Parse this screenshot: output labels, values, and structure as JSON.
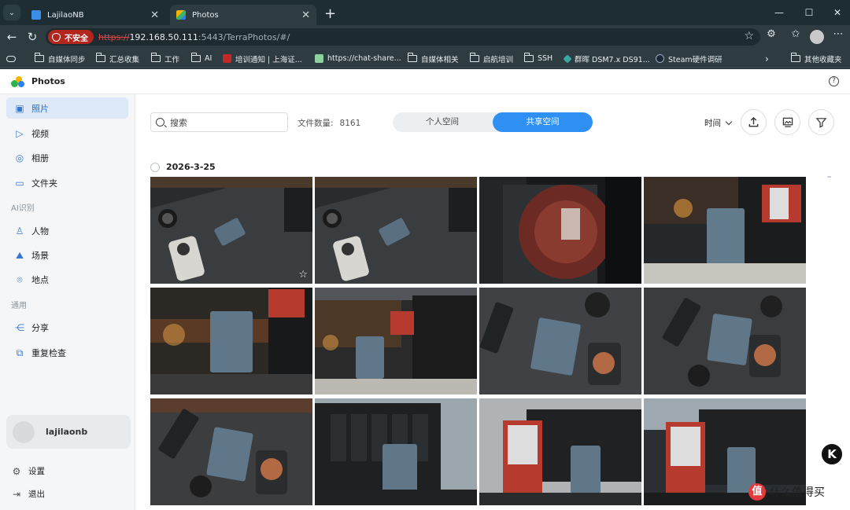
{
  "browser": {
    "tabs": [
      {
        "label": "LajilaoNB",
        "color": "#3a8ee6"
      },
      {
        "label": "Photos",
        "color": "#3bb36b"
      }
    ],
    "url": {
      "security_label": "不安全",
      "scheme": "https://",
      "host": "192.168.50.111",
      "path": ":5443/TerraPhotos/#/"
    },
    "bookmarks": [
      "自媒体同步",
      "汇总收集",
      "工作",
      "AI",
      "培训通知 | 上海证...",
      "https://chat-share...",
      "自媒体相关",
      "启航培训",
      "SSH",
      "群晖 DSM7.x DS91...",
      "Steam硬件调研",
      "其他收藏夹"
    ]
  },
  "app": {
    "title": "Photos",
    "nav": {
      "primary": [
        {
          "label": "照片",
          "icon": "photo-icon",
          "active": true
        },
        {
          "label": "视频",
          "icon": "video-icon"
        },
        {
          "label": "相册",
          "icon": "album-icon"
        },
        {
          "label": "文件夹",
          "icon": "folder-icon"
        }
      ],
      "section_ai": "AI识别",
      "ai": [
        {
          "label": "人物",
          "icon": "person-icon"
        },
        {
          "label": "场景",
          "icon": "scene-icon"
        },
        {
          "label": "地点",
          "icon": "location-icon"
        }
      ],
      "section_general": "通用",
      "general": [
        {
          "label": "分享",
          "icon": "share-icon"
        },
        {
          "label": "重复检查",
          "icon": "duplicate-icon"
        }
      ]
    },
    "user": {
      "name": "lajilaonb"
    },
    "bottom": [
      {
        "label": "设置",
        "icon": "gear-icon"
      },
      {
        "label": "退出",
        "icon": "logout-icon"
      },
      {
        "label": "收起",
        "icon": "collapse-icon"
      }
    ],
    "toolbar": {
      "search_placeholder": "搜索",
      "file_count_label": "文件数量:",
      "file_count": "8161",
      "space_personal": "个人空间",
      "space_shared": "共享空间",
      "sort_label": "时间"
    },
    "group_date": "2026-3-25",
    "photo_count": 12,
    "overlay": {
      "badge": "K",
      "watermark_logo": "值",
      "watermark_text": "什么值得买"
    }
  },
  "colors": {
    "accent": "#2f90f4",
    "nav_active_bg": "#dde9f7",
    "unsafe_red": "#b3261e"
  }
}
